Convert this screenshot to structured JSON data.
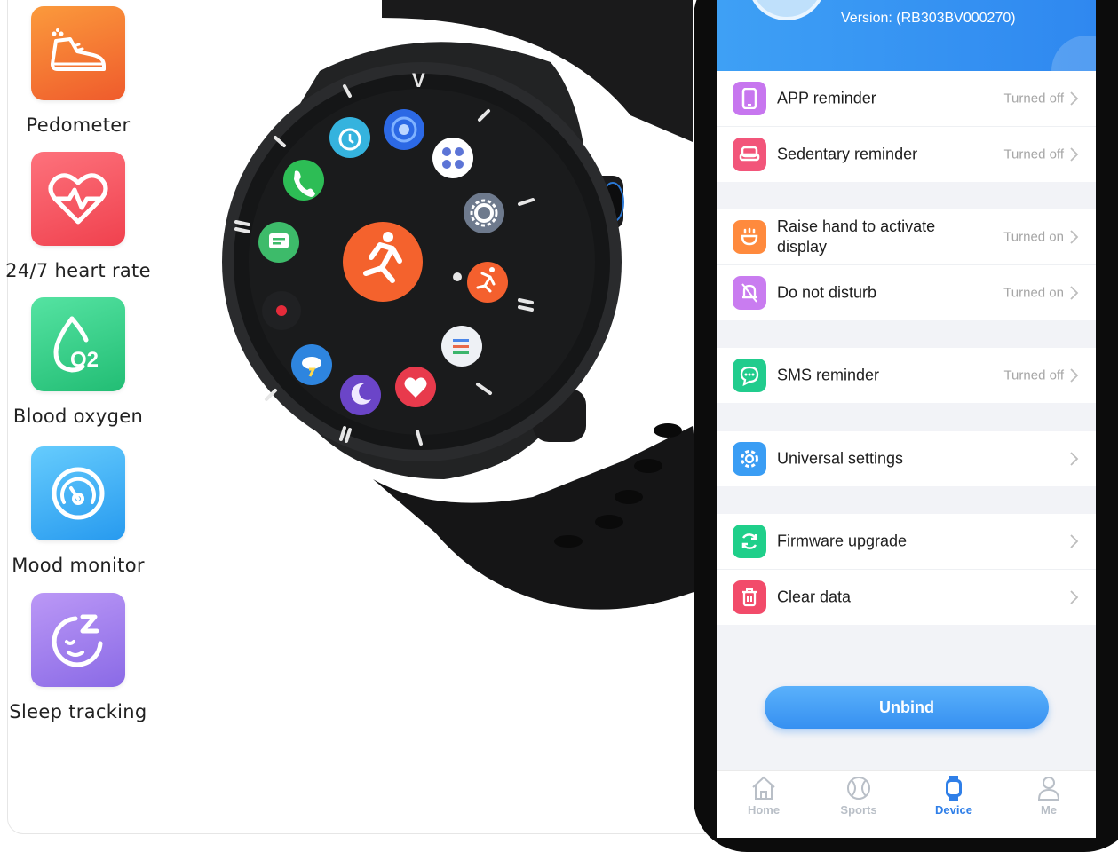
{
  "features": [
    {
      "label": "Pedometer",
      "icon": "running-shoe-icon",
      "color_top": "#f98a36",
      "color_bottom": "#f0602f"
    },
    {
      "label": "24/7 heart rate",
      "icon": "heartbeat-icon",
      "color_top": "#fb6b75",
      "color_bottom": "#f2444f"
    },
    {
      "label": "Blood oxygen",
      "icon": "oxygen-drop-icon",
      "color_top": "#4fdf9b",
      "color_bottom": "#27c27a"
    },
    {
      "label": "Mood monitor",
      "icon": "gauge-icon",
      "color_top": "#5cc5fb",
      "color_bottom": "#2e9ff0"
    },
    {
      "label": "Sleep tracking",
      "icon": "sleep-face-icon",
      "color_top": "#b592f4",
      "color_bottom": "#8e6ee8"
    }
  ],
  "watch": {
    "brand_mark": "V",
    "apps": [
      "phone-app-icon",
      "alarm-app-icon",
      "circle-app-icon",
      "grid-app-icon",
      "settings-app-icon",
      "workout-app-icon",
      "list-app-icon",
      "heart-app-icon",
      "sleep-app-icon",
      "weather-app-icon",
      "record-app-icon",
      "message-app-icon",
      "center-run-app-icon"
    ]
  },
  "app": {
    "header": {
      "version": "Version: (RB303BV000270)",
      "accent": "#3597f2"
    },
    "groups": [
      [
        {
          "label": "APP reminder",
          "status": "Turned off",
          "icon": "phone-icon",
          "color": "#c776ef"
        },
        {
          "label": "Sedentary reminder",
          "status": "Turned off",
          "icon": "seat-icon",
          "color": "#f2557a"
        }
      ],
      [
        {
          "label": "Raise hand to activate display",
          "status": "Turned on",
          "icon": "hand-icon",
          "color": "#ff8a3d"
        },
        {
          "label": "Do not disturb",
          "status": "Turned on",
          "icon": "bell-off-icon",
          "color": "#c97cf0"
        }
      ],
      [
        {
          "label": "SMS reminder",
          "status": "Turned off",
          "icon": "chat-icon",
          "color": "#21cc8d"
        }
      ],
      [
        {
          "label": "Universal settings",
          "status": "",
          "icon": "gear-icon",
          "color": "#3a9df4"
        }
      ],
      [
        {
          "label": "Firmware upgrade",
          "status": "",
          "icon": "refresh-icon",
          "color": "#1fcf8a"
        },
        {
          "label": "Clear data",
          "status": "",
          "icon": "trash-icon",
          "color": "#f24b6a"
        }
      ]
    ],
    "unbind_label": "Unbind",
    "tabs": [
      {
        "label": "Home",
        "icon": "home-icon",
        "active": false
      },
      {
        "label": "Sports",
        "icon": "ball-icon",
        "active": false
      },
      {
        "label": "Device",
        "icon": "watch-icon",
        "active": true
      },
      {
        "label": "Me",
        "icon": "person-icon",
        "active": false
      }
    ]
  }
}
